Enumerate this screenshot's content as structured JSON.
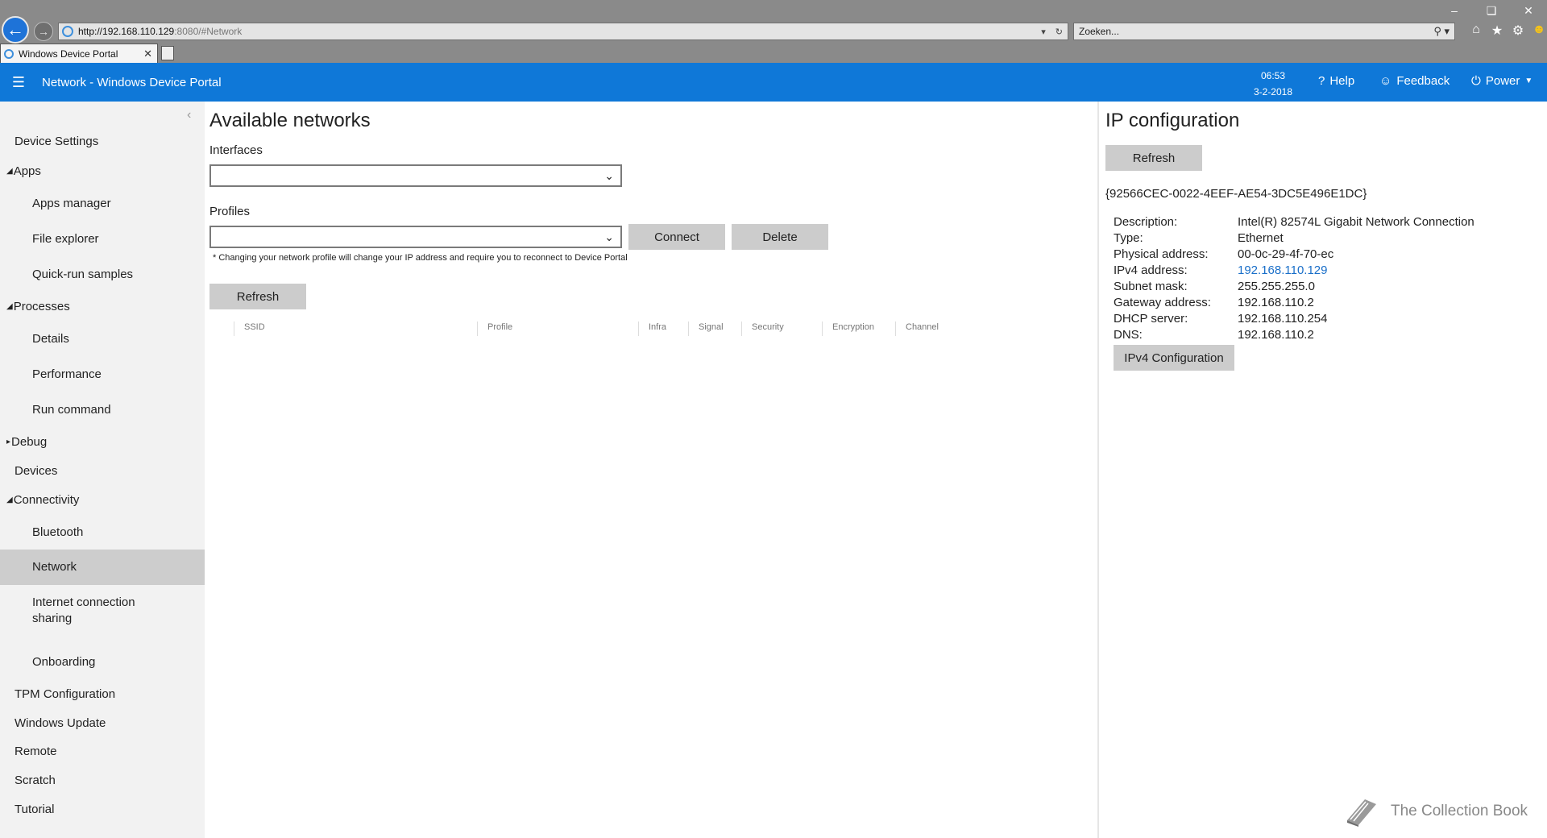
{
  "browser": {
    "url_host": "http://192.168.110.129",
    "url_rest": ":8080/#Network",
    "search_placeholder": "Zoeken...",
    "tab_title": "Windows Device Portal"
  },
  "header": {
    "title": "Network - Windows Device Portal",
    "time": "06:53",
    "date": "3-2-2018",
    "help_label": "Help",
    "feedback_label": "Feedback",
    "power_label": "Power"
  },
  "sidebar": {
    "items": [
      {
        "label": "Device Settings"
      },
      {
        "label": "Apps"
      },
      {
        "label": "Apps manager"
      },
      {
        "label": "File explorer"
      },
      {
        "label": "Quick-run samples"
      },
      {
        "label": "Processes"
      },
      {
        "label": "Details"
      },
      {
        "label": "Performance"
      },
      {
        "label": "Run command"
      },
      {
        "label": "Debug"
      },
      {
        "label": "Devices"
      },
      {
        "label": "Connectivity"
      },
      {
        "label": "Bluetooth"
      },
      {
        "label": "Network"
      },
      {
        "label": "Internet connection sharing"
      },
      {
        "label": "Onboarding"
      },
      {
        "label": "TPM Configuration"
      },
      {
        "label": "Windows Update"
      },
      {
        "label": "Remote"
      },
      {
        "label": "Scratch"
      },
      {
        "label": "Tutorial"
      }
    ]
  },
  "networks": {
    "title": "Available networks",
    "interfaces_label": "Interfaces",
    "interfaces_value": "",
    "profiles_label": "Profiles",
    "profiles_value": "",
    "connect_label": "Connect",
    "delete_label": "Delete",
    "note": "* Changing your network profile will change your IP address and require you to reconnect to Device Portal",
    "refresh_label": "Refresh",
    "columns": [
      "SSID",
      "Profile",
      "Infra",
      "Signal",
      "Security",
      "Encryption",
      "Channel"
    ]
  },
  "ipconfig": {
    "title": "IP configuration",
    "refresh_label": "Refresh",
    "adapter_id": "{92566CEC-0022-4EEF-AE54-3DC5E496E1DC}",
    "rows": [
      {
        "key": "Description:",
        "value": "Intel(R) 82574L Gigabit Network Connection"
      },
      {
        "key": "Type:",
        "value": "Ethernet"
      },
      {
        "key": "Physical address:",
        "value": "00-0c-29-4f-70-ec"
      },
      {
        "key": "IPv4 address:",
        "value": "192.168.110.129"
      },
      {
        "key": "Subnet mask:",
        "value": "255.255.255.0"
      },
      {
        "key": "Gateway address:",
        "value": "192.168.110.2"
      },
      {
        "key": "DHCP server:",
        "value": "192.168.110.254"
      },
      {
        "key": "DNS:",
        "value": "192.168.110.2"
      }
    ],
    "ipv4_config_label": "IPv4 Configuration"
  },
  "watermark": {
    "text": "The Collection Book"
  },
  "colors": {
    "accent": "#0f78d8",
    "link": "#1a6fc9",
    "button": "#cccccc",
    "sidebar": "#f2f2f2",
    "selected": "#cdcdcd"
  }
}
